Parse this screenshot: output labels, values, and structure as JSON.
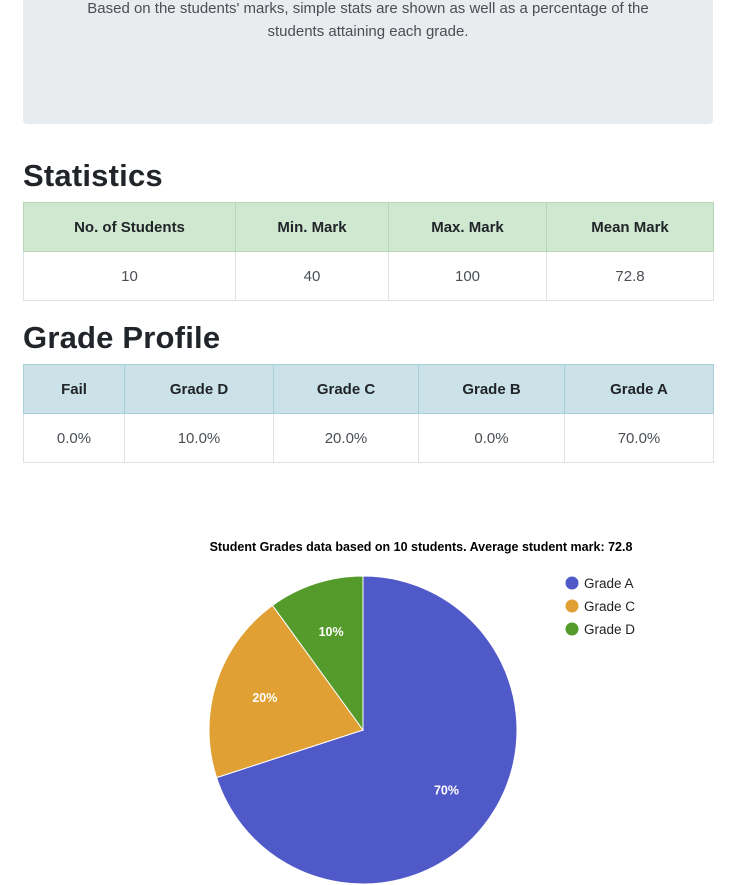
{
  "intro": {
    "line1": "Based on the students' marks, simple stats are shown as well as a percentage of the",
    "line2": "students attaining each grade."
  },
  "statistics": {
    "heading": "Statistics",
    "headers": [
      "No. of Students",
      "Min. Mark",
      "Max. Mark",
      "Mean Mark"
    ],
    "values": [
      "10",
      "40",
      "100",
      "72.8"
    ]
  },
  "grade_profile": {
    "heading": "Grade Profile",
    "headers": [
      "Fail",
      "Grade D",
      "Grade C",
      "Grade B",
      "Grade A"
    ],
    "values": [
      "0.0%",
      "10.0%",
      "20.0%",
      "0.0%",
      "70.0%"
    ]
  },
  "chart_data": {
    "type": "pie",
    "title": "Student Grades data based on 10 students. Average student mark: 72.8",
    "slices": [
      {
        "label": "Grade A",
        "value": 70,
        "display": "70%",
        "color": "#5059c8"
      },
      {
        "label": "Grade C",
        "value": 20,
        "display": "20%",
        "color": "#e0a033"
      },
      {
        "label": "Grade D",
        "value": 10,
        "display": "10%",
        "color": "#559b2b"
      }
    ],
    "legend_position": "right"
  }
}
